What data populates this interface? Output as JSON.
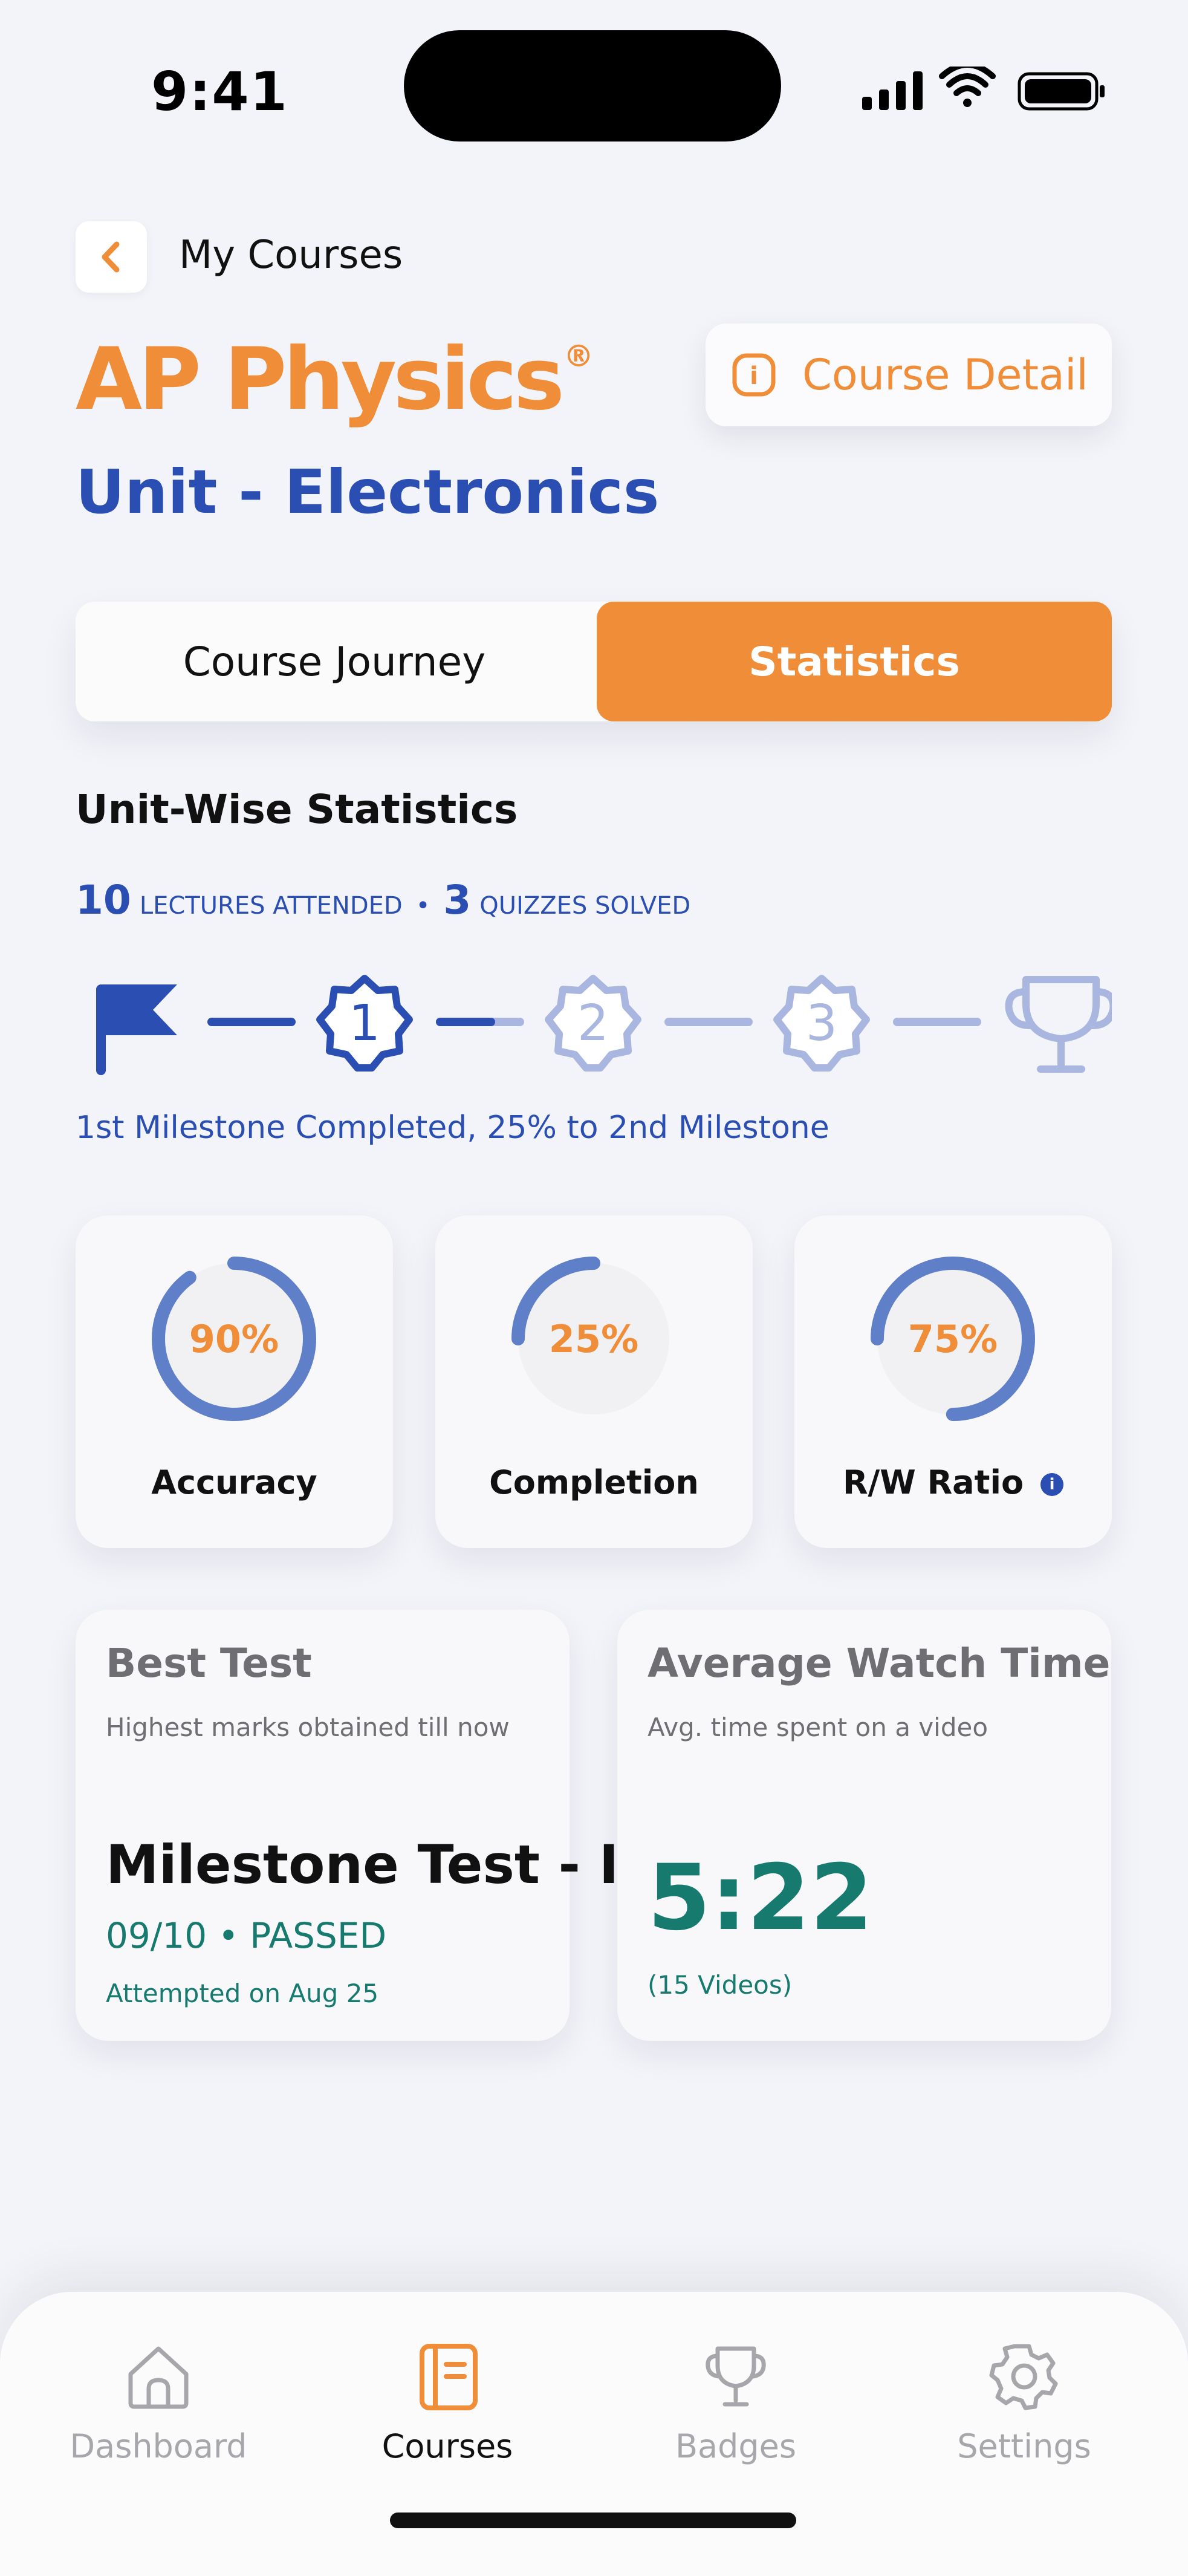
{
  "status_bar": {
    "time": "9:41"
  },
  "header": {
    "breadcrumb": "My Courses",
    "brand": "AP Physics",
    "brand_mark": "®",
    "unit_title": "Unit - Electronics",
    "detail_button": "Course Detail",
    "info_icon_glyph": "i"
  },
  "tabs": [
    {
      "label": "Course Journey",
      "selected": false
    },
    {
      "label": "Statistics",
      "selected": true
    }
  ],
  "statistics": {
    "title": "Unit-Wise Statistics",
    "lectures_count": "10",
    "lectures_label": "LECTURES ATTENDED",
    "separator": "•",
    "quizzes_count": "3",
    "quizzes_label": "QUIZZES SOLVED",
    "milestones": {
      "nodes": [
        "1",
        "2",
        "3"
      ],
      "progress_to_next": 0.25,
      "caption": "1st Milestone Completed, 25% to 2nd Milestone"
    },
    "cards": [
      {
        "label": "Accuracy",
        "value_text": "90%",
        "value": 90
      },
      {
        "label": "Completion",
        "value_text": "25%",
        "value": 25
      },
      {
        "label": "R/W Ratio",
        "value_text": "75%",
        "value": 75,
        "info_glyph": "i"
      }
    ],
    "best_test": {
      "title": "Best Test",
      "subtitle": "Highest marks obtained till now",
      "name": "Milestone Test - I",
      "score": "09/10 • PASSED",
      "date": "Attempted on Aug 25"
    },
    "watch_time": {
      "title": "Average Watch Time",
      "subtitle": "Avg. time spent on a video",
      "value": "5:22",
      "count": "(15 Videos)"
    }
  },
  "nav": [
    {
      "label": "Dashboard",
      "icon": "home-icon",
      "active": false
    },
    {
      "label": "Courses",
      "icon": "book-icon",
      "active": true
    },
    {
      "label": "Badges",
      "icon": "trophy-icon",
      "active": false
    },
    {
      "label": "Settings",
      "icon": "gear-icon",
      "active": false
    }
  ],
  "colors": {
    "accent": "#ef8d38",
    "primary": "#2a4eb2",
    "ring": "#5f7fc9",
    "light_blue": "#a9b7e0",
    "success": "#167a6f",
    "inactive": "#a7a7ab"
  }
}
